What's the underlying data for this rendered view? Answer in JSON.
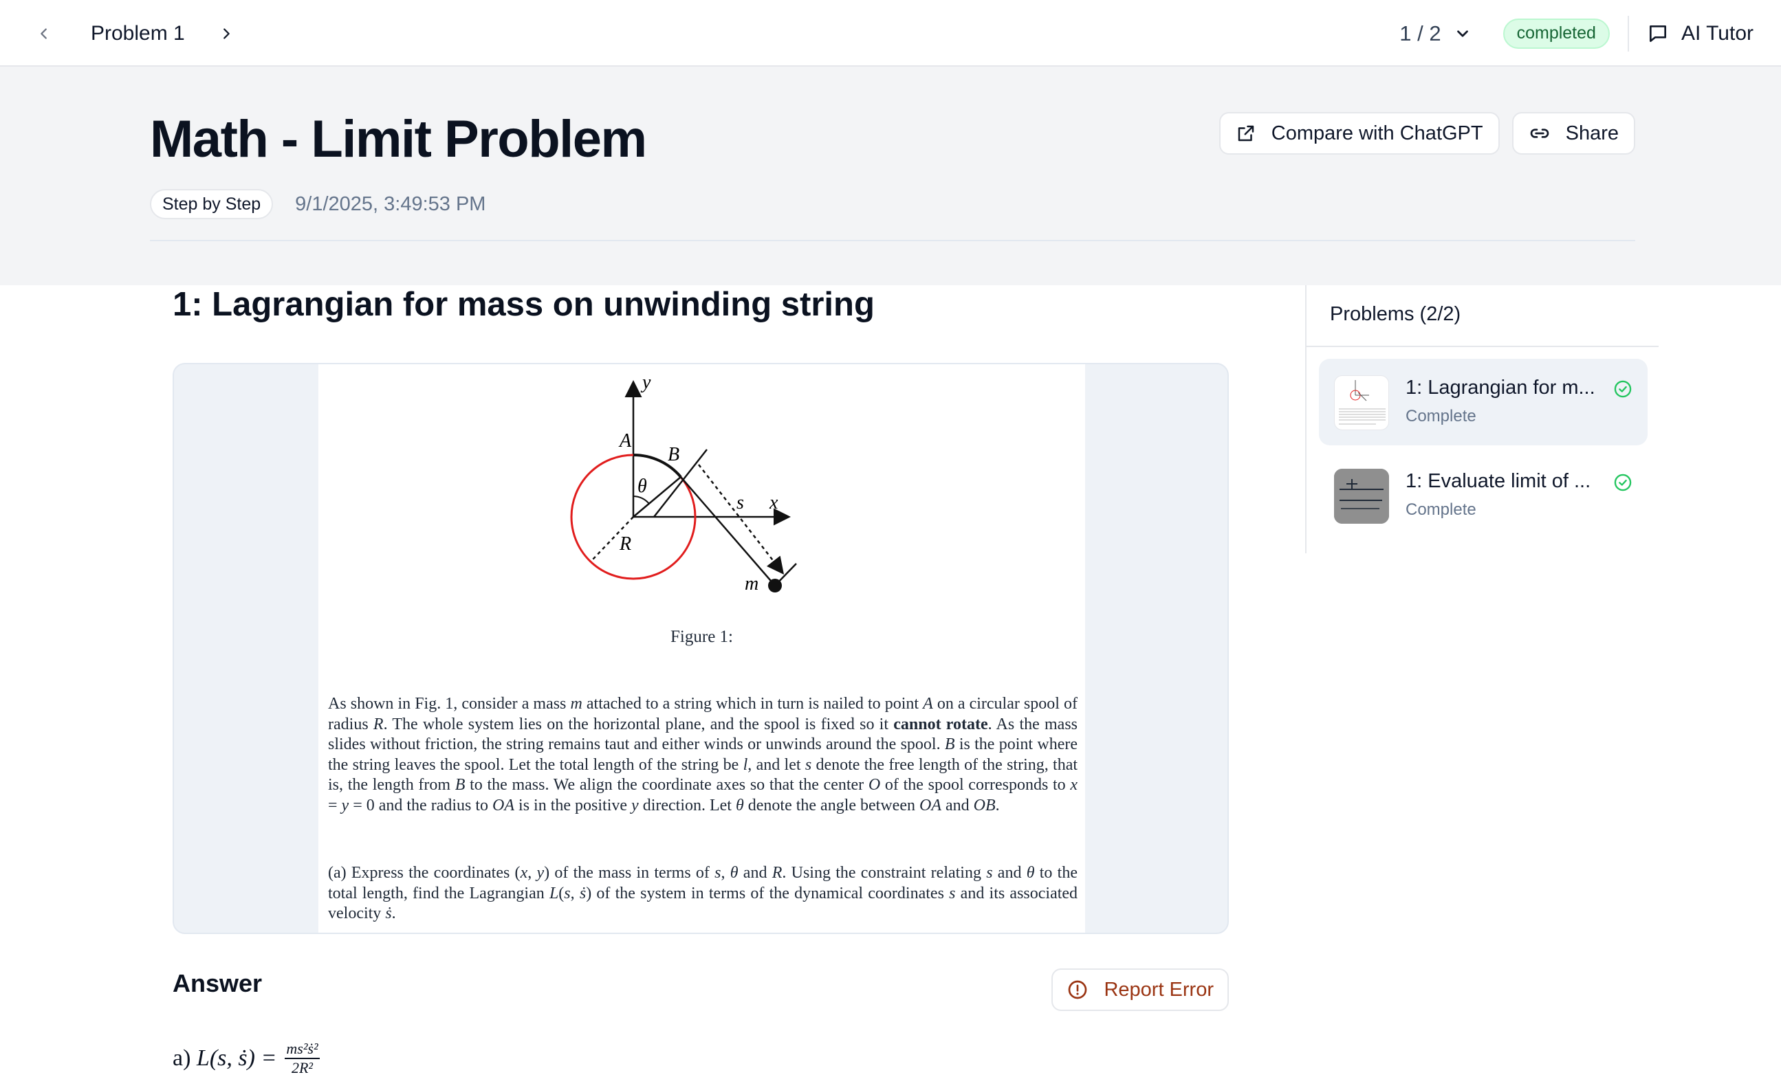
{
  "topbar": {
    "title": "Problem 1",
    "page_indicator": "1 / 2",
    "status_badge": "completed",
    "ai_tutor_label": "AI Tutor"
  },
  "header": {
    "title": "Math - Limit Problem",
    "mode_pill": "Step by Step",
    "timestamp": "9/1/2025, 3:49:53 PM",
    "compare_label": "Compare with ChatGPT",
    "share_label": "Share"
  },
  "problem": {
    "title": "1: Lagrangian for mass on unwinding string",
    "figure_caption": "Figure 1:",
    "figure_labels": {
      "y": "y",
      "x": "x",
      "A": "A",
      "B": "B",
      "theta": "θ",
      "s": "s",
      "R": "R",
      "m": "m"
    },
    "paragraph1_html": "As shown in Fig. 1, consider a mass <i>m</i> attached to a string which in turn is nailed to point <i>A</i> on a circular spool of radius <i>R</i>. The whole system lies on the horizontal plane, and the spool is fixed so it <b>cannot rotate</b>. As the mass slides without friction, the string remains taut and either winds or unwinds around the spool. <i>B</i> is the point where the string leaves the spool. Let the total length of the string be <i>l</i>, and let <i>s</i> denote the free length of the string, that is, the length from <i>B</i> to the mass. We align the coordinate axes so that the center <i>O</i> of the spool corresponds to <i>x</i> = <i>y</i> = 0 and the radius to <i>OA</i> is in the positive <i>y</i> direction. Let <i>θ</i> denote the angle between <i>OA</i> and <i>OB</i>.",
    "paragraph2_html": "(a) Express the coordinates (<i>x</i>, <i>y</i>) of the mass in terms of <i>s</i>, <i>θ</i> and <i>R</i>. Using the constraint relating <i>s</i> and <i>θ</i> to the total length, find the Lagrangian <i>L</i>(<i>s</i>, <i>ṡ</i>) of the system in terms of the dynamical coordinates <i>s</i> and its associated velocity <i>ṡ</i>."
  },
  "answer": {
    "heading": "Answer",
    "report_label": "Report Error",
    "prefix": "a) ",
    "lhs": "L(s, ṡ) =",
    "numerator": "ms²ṡ²",
    "denominator": "2R²"
  },
  "sidebar": {
    "heading": "Problems (2/2)",
    "items": [
      {
        "title": "1: Lagrangian for m...",
        "status": "Complete"
      },
      {
        "title": "1: Evaluate limit of ...",
        "status": "Complete"
      }
    ]
  },
  "colors": {
    "accent_green": "#22c55e",
    "badge_bg": "#dcfce7",
    "report_text": "#9a3412",
    "spool_red": "#e11d1d"
  }
}
